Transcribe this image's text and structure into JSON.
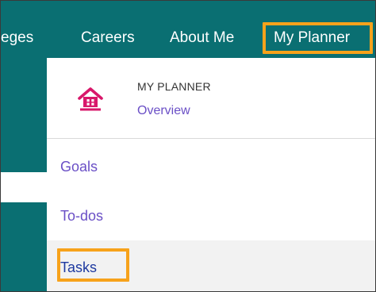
{
  "nav": {
    "items": [
      {
        "label": "eges"
      },
      {
        "label": "Careers"
      },
      {
        "label": "About Me"
      },
      {
        "label": "My Planner"
      }
    ]
  },
  "dropdown": {
    "title": "MY PLANNER",
    "overview_link": "Overview",
    "icon": "house-icon",
    "items": [
      {
        "label": "Goals"
      },
      {
        "label": "To-dos"
      },
      {
        "label": "Tasks"
      }
    ]
  },
  "colors": {
    "nav_bg": "#0a6f72",
    "highlight": "#f7a21b",
    "link": "#6a4fc6",
    "icon": "#d8176a"
  }
}
